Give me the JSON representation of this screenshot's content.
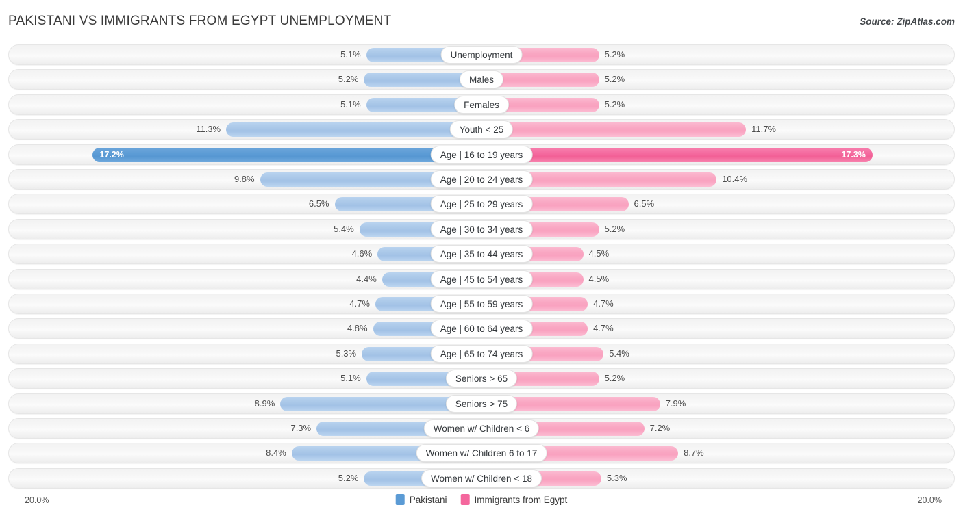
{
  "header": {
    "title": "PAKISTANI VS IMMIGRANTS FROM EGYPT UNEMPLOYMENT",
    "source": "Source: ZipAtlas.com"
  },
  "legend": {
    "items": [
      {
        "label": "Pakistani",
        "color": "#5b9bd5"
      },
      {
        "label": "Immigrants from Egypt",
        "color": "#f4679d"
      }
    ]
  },
  "axis": {
    "left_label": "20.0%",
    "right_label": "20.0%",
    "max": 20.0
  },
  "colors": {
    "left_normal": "#a9c7e8",
    "left_highlight": "#5b9bd5",
    "right_normal": "#f9a6c2",
    "right_highlight": "#f4679d",
    "track": "#f6f6f6",
    "text": "#4c4c4c"
  },
  "chart_data": {
    "type": "bar",
    "title": "PAKISTANI VS IMMIGRANTS FROM EGYPT UNEMPLOYMENT",
    "subtitle": "",
    "xlabel": "",
    "ylabel": "",
    "orientation": "horizontal-diverging",
    "xlim": [
      20.0,
      20.0
    ],
    "grid": false,
    "legend_position": "bottom-center",
    "categories": [
      "Unemployment",
      "Males",
      "Females",
      "Youth < 25",
      "Age | 16 to 19 years",
      "Age | 20 to 24 years",
      "Age | 25 to 29 years",
      "Age | 30 to 34 years",
      "Age | 35 to 44 years",
      "Age | 45 to 54 years",
      "Age | 55 to 59 years",
      "Age | 60 to 64 years",
      "Age | 65 to 74 years",
      "Seniors > 65",
      "Seniors > 75",
      "Women w/ Children < 6",
      "Women w/ Children 6 to 17",
      "Women w/ Children < 18"
    ],
    "series": [
      {
        "name": "Pakistani",
        "side": "left",
        "color": "#a9c7e8",
        "values": [
          5.1,
          5.2,
          5.1,
          11.3,
          17.2,
          9.8,
          6.5,
          5.4,
          4.6,
          4.4,
          4.7,
          4.8,
          5.3,
          5.1,
          8.9,
          7.3,
          8.4,
          5.2
        ],
        "labels": [
          "5.1%",
          "5.2%",
          "5.1%",
          "11.3%",
          "17.2%",
          "9.8%",
          "6.5%",
          "5.4%",
          "4.6%",
          "4.4%",
          "4.7%",
          "4.8%",
          "5.3%",
          "5.1%",
          "8.9%",
          "7.3%",
          "8.4%",
          "5.2%"
        ]
      },
      {
        "name": "Immigrants from Egypt",
        "side": "right",
        "color": "#f9a6c2",
        "values": [
          5.2,
          5.2,
          5.2,
          11.7,
          17.3,
          10.4,
          6.5,
          5.2,
          4.5,
          4.5,
          4.7,
          4.7,
          5.4,
          5.2,
          7.9,
          7.2,
          8.7,
          5.3
        ],
        "labels": [
          "5.2%",
          "5.2%",
          "5.2%",
          "11.7%",
          "17.3%",
          "10.4%",
          "6.5%",
          "5.2%",
          "4.5%",
          "4.5%",
          "4.7%",
          "4.7%",
          "5.4%",
          "5.2%",
          "7.9%",
          "7.2%",
          "8.7%",
          "5.3%"
        ]
      }
    ],
    "highlighted_row_index": 4
  }
}
